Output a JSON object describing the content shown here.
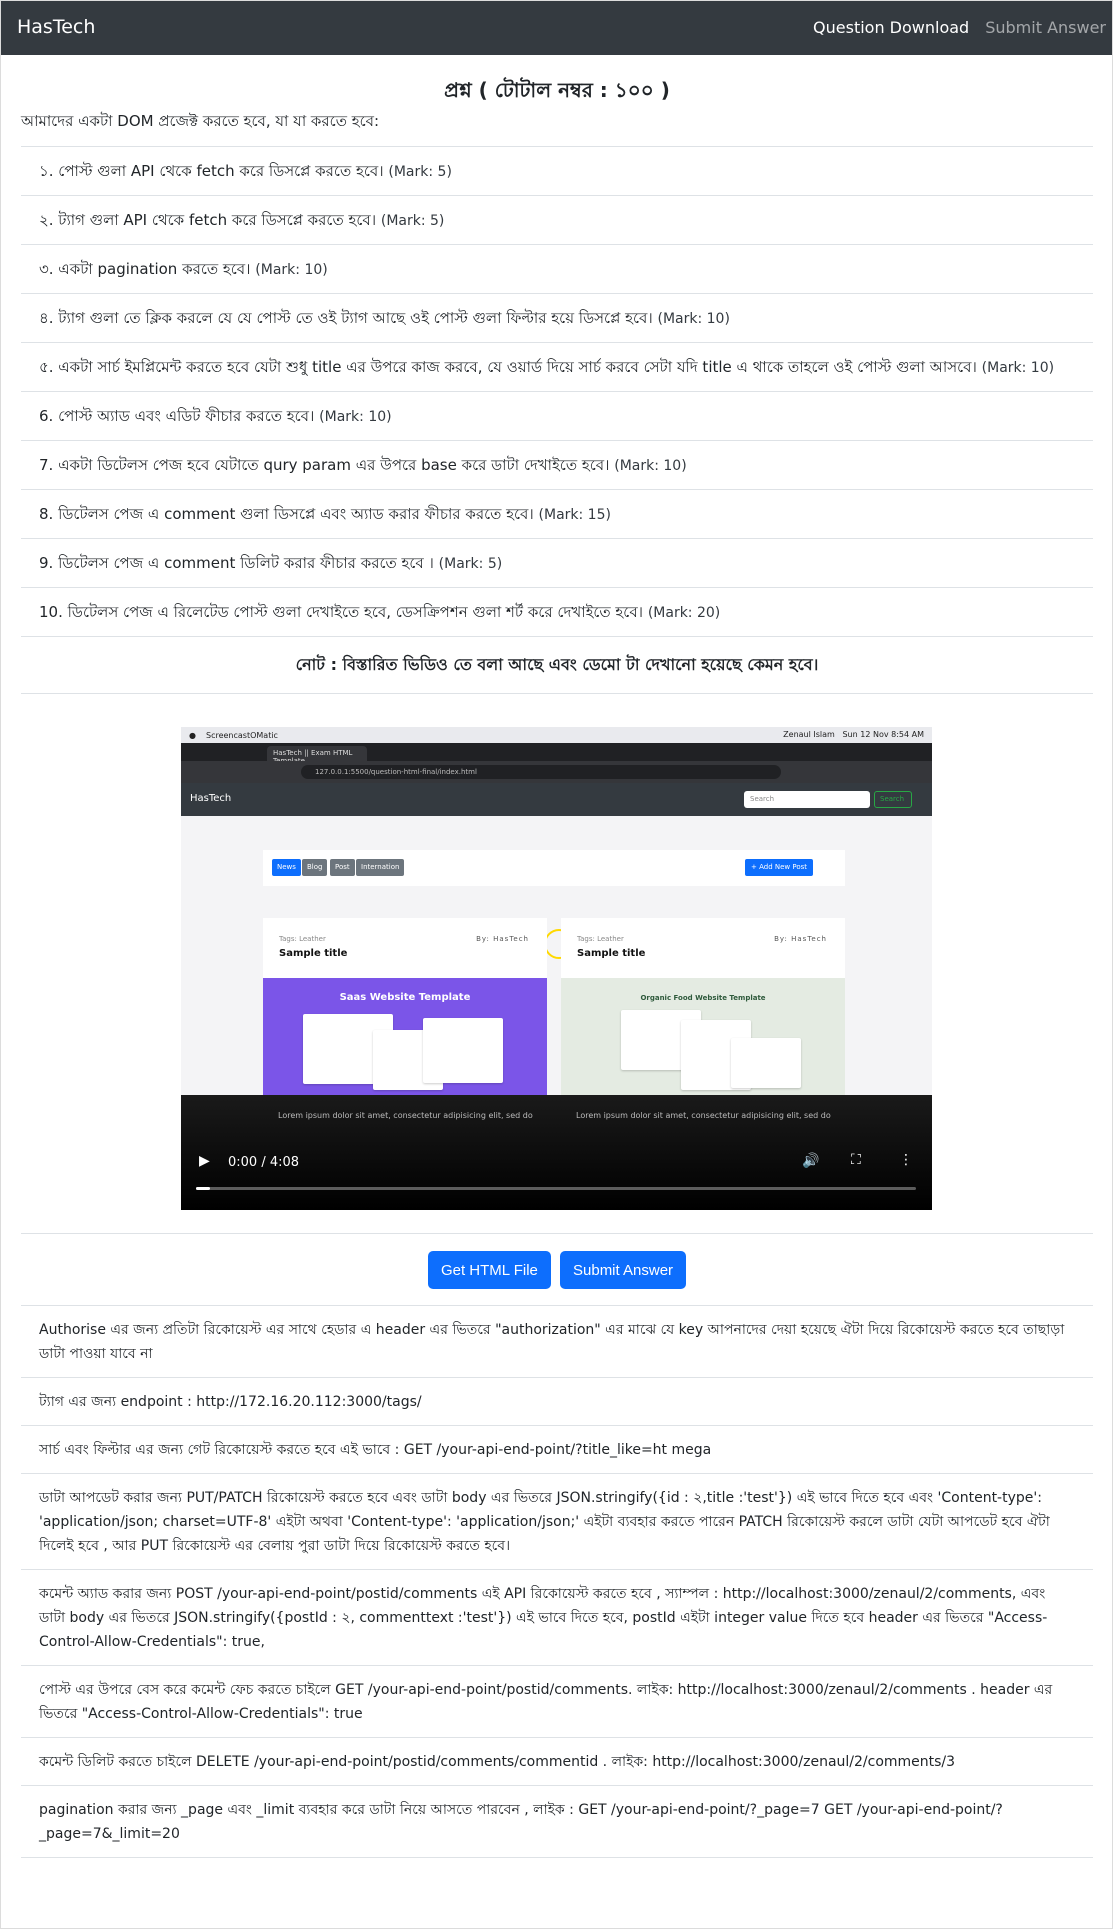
{
  "navbar": {
    "brand": "HasTech",
    "links": [
      "Question Download",
      "Submit Answer"
    ]
  },
  "question": {
    "title": "প্রশ্ন ( টোটাল নম্বর : ১০০ )",
    "intro": "আমাদের একটা DOM প্রজেক্ট করতে হবে, যা যা করতে হবে:",
    "items": [
      {
        "text": "১. পোস্ট গুলা API থেকে fetch করে ডিসপ্লে করতে হবে।",
        "mark": "(Mark: 5)"
      },
      {
        "text": "২. ট্যাগ গুলা API থেকে fetch করে ডিসপ্লে করতে হবে।",
        "mark": "(Mark: 5)"
      },
      {
        "text": "৩. একটা pagination করতে হবে।",
        "mark": "(Mark: 10)"
      },
      {
        "text": "৪. ট্যাগ গুলা তে ক্লিক করলে যে যে পোস্ট তে ওই ট্যাগ আছে ওই পোস্ট গুলা ফিল্টার হয়ে ডিসপ্লে হবে।",
        "mark": "(Mark: 10)"
      },
      {
        "text": "৫. একটা সার্চ ইমপ্লিমেন্ট করতে হবে যেটা শুধু title এর উপরে কাজ করবে, যে ওয়ার্ড দিয়ে সার্চ করবে সেটা যদি title এ থাকে তাহলে ওই পোস্ট গুলা আসবে।",
        "mark": "(Mark: 10)"
      },
      {
        "text": "6. পোস্ট অ্যাড এবং এডিট ফীচার করতে হবে।",
        "mark": "(Mark: 10)"
      },
      {
        "text": "7. একটা ডিটেলস পেজ হবে যেটাতে qury param এর উপরে base করে ডাটা দেখাইতে হবে।",
        "mark": "(Mark: 10)"
      },
      {
        "text": "8. ডিটেলস পেজ এ comment গুলা ডিসপ্লে এবং অ্যাড করার ফীচার করতে হবে।",
        "mark": "(Mark: 15)"
      },
      {
        "text": "9. ডিটেলস পেজ এ comment ডিলিট করার ফীচার করতে হবে ।",
        "mark": "(Mark: 5)"
      },
      {
        "text": "10. ডিটেলস পেজ এ রিলেটেড পোস্ট গুলা দেখাইতে হবে, ডেসক্রিপশন গুলা শর্ট করে দেখাইতে হবে।",
        "mark": "(Mark: 20)"
      }
    ],
    "note": "নোট : বিস্তারিত ভিডিও তে বলা আছে এবং ডেমো টা দেখানো হয়েছে কেমন হবে।"
  },
  "video": {
    "mac_app": "ScreencastOMatic",
    "mac_user": "Zenaul Islam",
    "mac_clock": "Sun 12 Nov 8:54 AM",
    "tab_title": "HasTech || Exam HTML Template",
    "url": "127.0.0.1:5500/question-html-final/index.html",
    "site_brand": "HasTech",
    "search_placeholder": "Search",
    "search_button": "Search",
    "tags": [
      "News",
      "Blog",
      "Post",
      "Internation"
    ],
    "add_post": "+ Add New Post",
    "cards": [
      {
        "tags_label": "Tags:",
        "tag": "Leather",
        "by": "By: HasTech",
        "title": "Sample title",
        "thumb_title": "Saas Website Template",
        "caption": "Lorem ipsum dolor sit amet, consectetur adipisicing elit, sed do"
      },
      {
        "tags_label": "Tags:",
        "tag": "Leather",
        "by": "By: HasTech",
        "title": "Sample title",
        "thumb_title": "Organic Food Website Template",
        "caption": "Lorem ipsum dolor sit amet, consectetur adipisicing elit, sed do"
      }
    ],
    "time": "0:00 / 4:08",
    "progress": 0.02
  },
  "buttons": {
    "get_html": "Get HTML File",
    "submit": "Submit Answer"
  },
  "info": [
    "Authorise এর জন্য প্রতিটা রিকোয়েস্ট এর সাথে হেডার এ header এর ভিতরে \"authorization\" এর মাঝে যে key আপনাদের দেয়া হয়েছে ঐটা দিয়ে রিকোয়েস্ট করতে হবে তাছাড়া ডাটা পাওয়া যাবে না",
    "ট্যাগ এর জন্য endpoint : http://172.16.20.112:3000/tags/",
    "সার্চ এবং ফিল্টার এর জন্য গেট রিকোয়েস্ট করতে হবে এই ভাবে : GET /your-api-end-point/?title_like=ht mega",
    "ডাটা আপডেট করার জন্য PUT/PATCH রিকোয়েস্ট করতে হবে এবং ডাটা body এর ভিতরে JSON.stringify({id : ২,title :'test'}) এই ভাবে দিতে হবে এবং 'Content-type': 'application/json; charset=UTF-8' এইটা অথবা 'Content-type': 'application/json;' এইটা ব্যবহার করতে পারেন PATCH রিকোয়েস্ট করলে ডাটা যেটা আপডেট হবে ঐটা দিলেই হবে , আর PUT রিকোয়েস্ট এর বেলায় পুরা ডাটা দিয়ে রিকোয়েস্ট করতে হবে।",
    "কমেন্ট অ্যাড করার জন্য POST /your-api-end-point/postid/comments এই API রিকোয়েস্ট করতে হবে , স্যাম্পল : http://localhost:3000/zenaul/2/comments, এবং ডাটা body এর ভিতরে JSON.stringify({postId : ২, commenttext :'test'}) এই ভাবে দিতে হবে, postId এইটা integer value দিতে হবে header এর ভিতরে \"Access-Control-Allow-Credentials\": true,",
    "পোস্ট এর উপরে বেস করে কমেন্ট ফেচ করতে চাইলে GET /your-api-end-point/postid/comments. লাইক: http://localhost:3000/zenaul/2/comments . header এর ভিতরে \"Access-Control-Allow-Credentials\": true",
    "কমেন্ট ডিলিট করতে চাইলে DELETE /your-api-end-point/postid/comments/commentid . লাইক: http://localhost:3000/zenaul/2/comments/3",
    "pagination করার জন্য _page এবং _limit ব্যবহার করে ডাটা নিয়ে আসতে পারবেন , লাইক : GET /your-api-end-point/?_page=7 GET /your-api-end-point/?_page=7&_limit=20"
  ],
  "colors": {
    "navbar": "#343a40",
    "primary": "#0d6efd",
    "success": "#28a745",
    "tag_active": "#0d6efd",
    "tag_inactive": "#6c757d"
  }
}
